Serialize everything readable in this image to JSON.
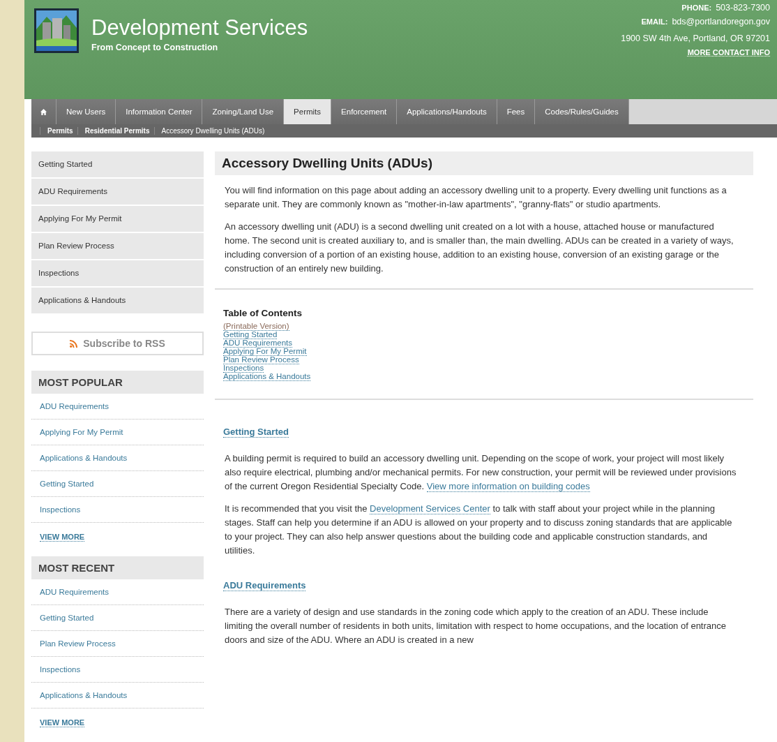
{
  "header": {
    "title": "Development Services",
    "tagline": "From Concept to Construction",
    "phone_label": "PHONE:",
    "phone": "503-823-7300",
    "email_label": "EMAIL:",
    "email": "bds@portlandoregon.gov",
    "address": "1900 SW 4th Ave, Portland, OR 97201",
    "contact_link": "MORE CONTACT INFO"
  },
  "tabs": [
    {
      "label": "New Users",
      "selected": false
    },
    {
      "label": "Information Center",
      "selected": false
    },
    {
      "label": "Zoning/Land Use",
      "selected": false
    },
    {
      "label": "Permits",
      "selected": true
    },
    {
      "label": "Enforcement",
      "selected": false
    },
    {
      "label": "Applications/Handouts",
      "selected": false
    },
    {
      "label": "Fees",
      "selected": false
    },
    {
      "label": "Codes/Rules/Guides",
      "selected": false
    }
  ],
  "breadcrumb": [
    "Permits",
    "Residential Permits",
    "Accessory Dwelling Units (ADUs)"
  ],
  "sidebar": {
    "nav": [
      "Getting Started",
      "ADU Requirements",
      "Applying For My Permit",
      "Plan Review Process",
      "Inspections",
      "Applications & Handouts"
    ],
    "rss_button": "Subscribe to RSS",
    "sections": [
      {
        "title": "MOST POPULAR",
        "items": [
          "ADU Requirements",
          "Applying For My Permit",
          "Applications & Handouts",
          "Getting Started",
          "Inspections"
        ],
        "more": "VIEW MORE"
      },
      {
        "title": "MOST RECENT",
        "items": [
          "ADU Requirements",
          "Getting Started",
          "Plan Review Process",
          "Inspections",
          "Applications & Handouts"
        ],
        "more": "VIEW MORE"
      }
    ]
  },
  "main": {
    "title": "Accessory Dwelling Units (ADUs)",
    "intro": [
      [
        {
          "text": "You will find information on this page about adding an accessory dwelling unit to a property. Every dwelling unit functions as a separate unit. They are commonly known as \"mother-in-law apartments\", \"granny-flats\" or studio apartments."
        }
      ],
      [
        {
          "text": "An accessory dwelling unit (ADU) is a second dwelling unit created on a lot with a house, attached house or manufactured home. The second unit is created auxiliary to, and is smaller than, the main dwelling. ADUs can be created in a variety of ways, including conversion of a portion of an existing house, addition to an existing house, conversion of an existing garage or the construction of an entirely new building."
        }
      ]
    ],
    "toc": {
      "title": "Table of Contents",
      "links": [
        "(Printable Version)",
        "Getting Started",
        "ADU Requirements",
        "Applying For My Permit",
        "Plan Review Process",
        "Inspections",
        "Applications & Handouts"
      ]
    },
    "sections": [
      {
        "heading": "Getting Started",
        "paragraphs": [
          [
            {
              "text": "A building permit is required to build an accessory dwelling unit. Depending on the scope of work, your project will most likely also require electrical, plumbing and/or mechanical permits. For new construction, your permit will be reviewed under provisions of the current Oregon Residential Specialty Code. "
            },
            {
              "text": "View more information on building codes",
              "kind": "link"
            }
          ],
          [
            {
              "text": "It is recommended that you visit the "
            },
            {
              "text": "Development Services Center",
              "kind": "link"
            },
            {
              "text": " to talk with staff about your project while in the planning stages. Staff can help you determine if an ADU is allowed on your property and to discuss zoning standards that are applicable to your project. They can also help answer questions about the building code and applicable construction standards, and utilities."
            }
          ]
        ]
      },
      {
        "heading": "ADU Requirements",
        "paragraphs": [
          [
            {
              "text": "There are a variety of design and use standards in the zoning code which apply to the creation of an ADU. These include limiting the overall number of residents in both units, limitation with respect to home occupations, and the location of entrance doors and size of the ADU. Where an ADU is created in a new"
            }
          ]
        ]
      }
    ]
  }
}
